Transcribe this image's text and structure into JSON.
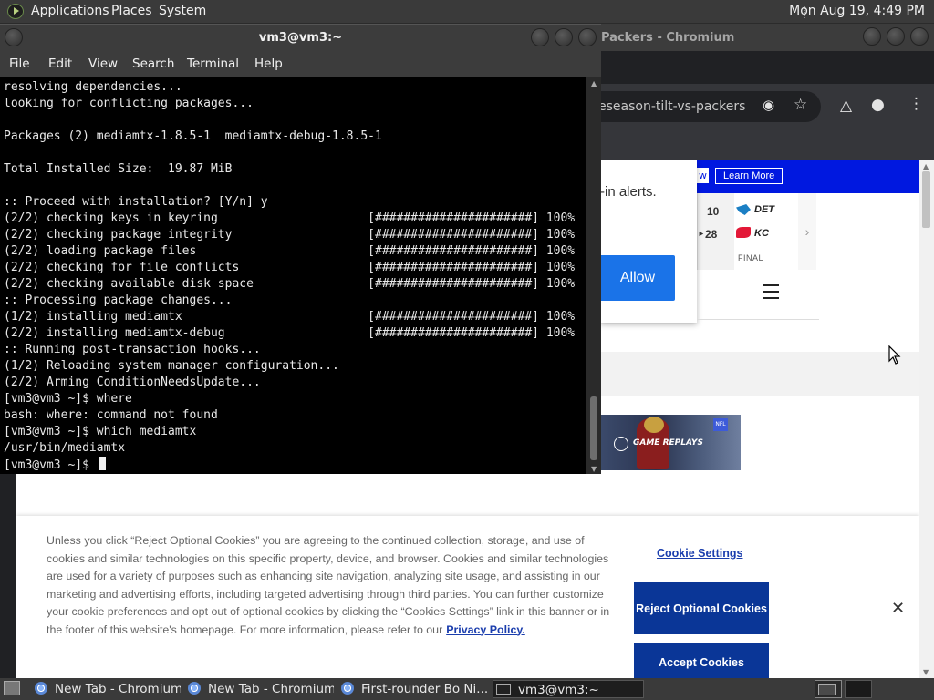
{
  "top_panel": {
    "menus": [
      "Applications",
      "Places",
      "System"
    ],
    "clock": "Mon Aug 19,  4:49 PM"
  },
  "chromium": {
    "window_title": "Packers - Chromium",
    "url": "eseason-tilt-vs-packers",
    "page": {
      "banner_partial": "w",
      "learn_more": "Learn More",
      "notification_text": "-in alerts.",
      "allow_button": "Allow",
      "scores": {
        "col1": [
          "10",
          "28"
        ],
        "teams": [
          "DET",
          "KC"
        ],
        "status": "FINAL"
      },
      "video_label": "GAME REPLAYS",
      "cookie": {
        "text": "Unless you click “Reject Optional Cookies” you are agreeing to the continued collection, storage, and use of cookies and similar technologies on this specific property, device, and browser. Cookies and similar technologies are used for a variety of purposes such as enhancing site navigation, analyzing site usage, and assisting in our marketing and advertising efforts, including targeted advertising through third parties. You can further customize your cookie preferences and opt out of optional cookies by clicking the “Cookies Settings” link in this banner or in the footer of this website's homepage. For more information, please refer to our",
        "privacy_link": "Privacy Policy.",
        "settings_link": "Cookie Settings",
        "reject_button": "Reject Optional Cookies",
        "accept_button": "Accept Cookies",
        "close": "✕"
      }
    }
  },
  "terminal": {
    "title": "vm3@vm3:~",
    "menus": [
      "File",
      "Edit",
      "View",
      "Search",
      "Terminal",
      "Help"
    ],
    "output": "resolving dependencies...\nlooking for conflicting packages...\n\nPackages (2) mediamtx-1.8.5-1  mediamtx-debug-1.8.5-1\n\nTotal Installed Size:  19.87 MiB\n\n:: Proceed with installation? [Y/n] y\n(2/2) checking keys in keyring                     [######################] 100%\n(2/2) checking package integrity                   [######################] 100%\n(2/2) loading package files                        [######################] 100%\n(2/2) checking for file conflicts                  [######################] 100%\n(2/2) checking available disk space                [######################] 100%\n:: Processing package changes...\n(1/2) installing mediamtx                          [######################] 100%\n(2/2) installing mediamtx-debug                    [######################] 100%\n:: Running post-transaction hooks...\n(1/2) Reloading system manager configuration...\n(2/2) Arming ConditionNeedsUpdate...\n[vm3@vm3 ~]$ where\nbash: where: command not found\n[vm3@vm3 ~]$ which mediamtx\n/usr/bin/mediamtx\n",
    "prompt": "[vm3@vm3 ~]$ "
  },
  "taskbar": {
    "items": [
      "New Tab - Chromium",
      "New Tab - Chromium",
      "First-rounder Bo Ni...",
      "vm3@vm3:~"
    ]
  },
  "colors": {
    "panel_bg": "#3a3a3a",
    "terminal_bg": "#000000",
    "cookie_button": "#0a3697",
    "allow_button": "#1a73e8",
    "site_banner": "#0018e0"
  }
}
